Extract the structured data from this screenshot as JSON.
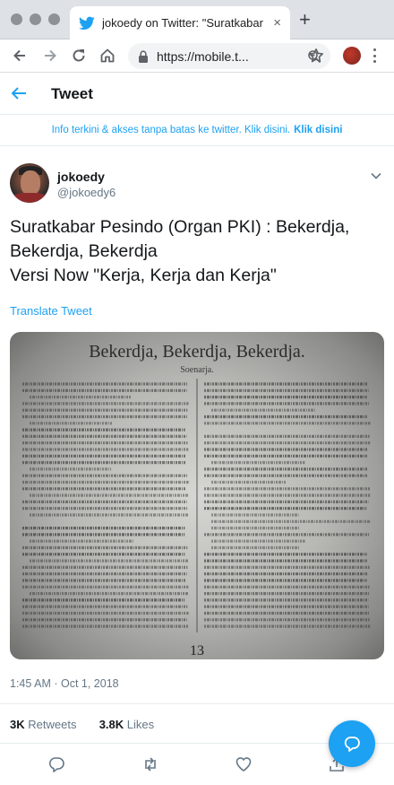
{
  "browser": {
    "tab_title": "jokoedy on Twitter: \"Suratkabar",
    "tab_close": "×",
    "new_tab": "+",
    "url": "https://mobile.t...",
    "icons": [
      "back-arrow-icon",
      "forward-arrow-icon",
      "reload-icon",
      "home-icon",
      "lock-icon",
      "zoom-icon",
      "star-icon",
      "profile-icon",
      "menu-icon"
    ]
  },
  "header": {
    "title": "Tweet"
  },
  "banner": {
    "text": "Info terkini & akses tanpa batas ke twitter. Klik disini.",
    "link": "Klik disini"
  },
  "tweet": {
    "name": "jokoedy",
    "handle": "@jokoedy6",
    "text_lines": [
      "Suratkabar Pesindo (Organ PKI) : Bekerdja,",
      "Bekerdja, Bekerdja",
      "Versi Now \"Kerja, Kerja dan Kerja\""
    ],
    "translate": "Translate Tweet",
    "photo": {
      "headline": "Bekerdja, Bekerdja, Bekerdja.",
      "byline": "Soenarja.",
      "page_number": "13"
    },
    "timestamp": "1:45 AM · Oct 1, 2018",
    "retweets_count": "3K",
    "retweets_label": "Retweets",
    "likes_count": "3.8K",
    "likes_label": "Likes"
  },
  "colors": {
    "accent": "#1da1f2",
    "text": "#14171a",
    "muted": "#657786"
  }
}
